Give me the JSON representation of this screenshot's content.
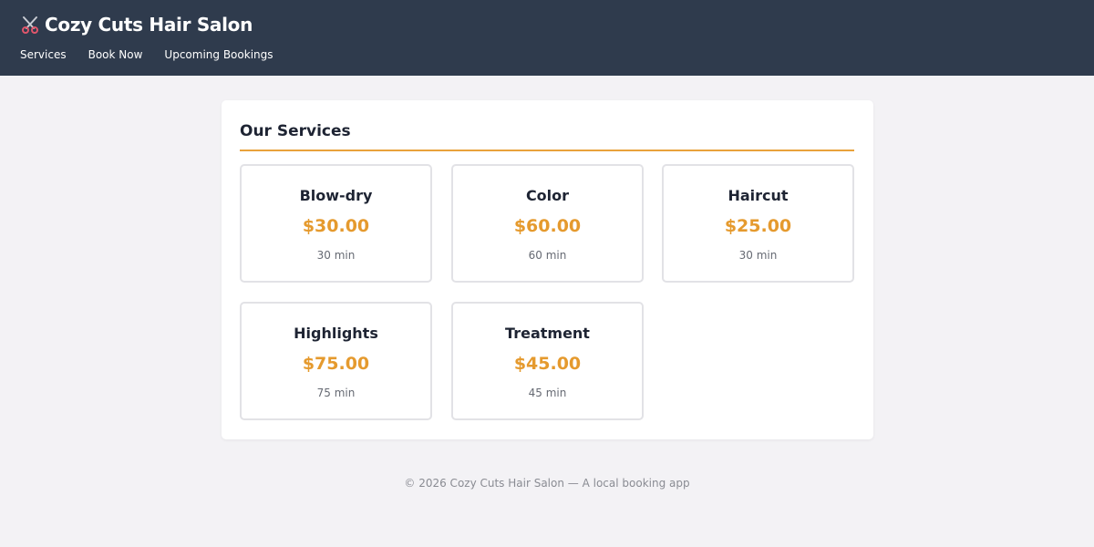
{
  "header": {
    "title": "Cozy Cuts Hair Salon",
    "icon": "scissors-icon",
    "nav": [
      {
        "label": "Services"
      },
      {
        "label": "Book Now"
      },
      {
        "label": "Upcoming Bookings"
      }
    ],
    "background": "#2f3b4d"
  },
  "services": {
    "title": "Our Services",
    "accent": "#e9a23b",
    "items": [
      {
        "name": "Blow-dry",
        "price": "$30.00",
        "duration": "30 min"
      },
      {
        "name": "Color",
        "price": "$60.00",
        "duration": "60 min"
      },
      {
        "name": "Haircut",
        "price": "$25.00",
        "duration": "30 min"
      },
      {
        "name": "Highlights",
        "price": "$75.00",
        "duration": "75 min"
      },
      {
        "name": "Treatment",
        "price": "$45.00",
        "duration": "45 min"
      }
    ]
  },
  "footer": {
    "text": "© 2026 Cozy Cuts Hair Salon — A local booking app"
  }
}
